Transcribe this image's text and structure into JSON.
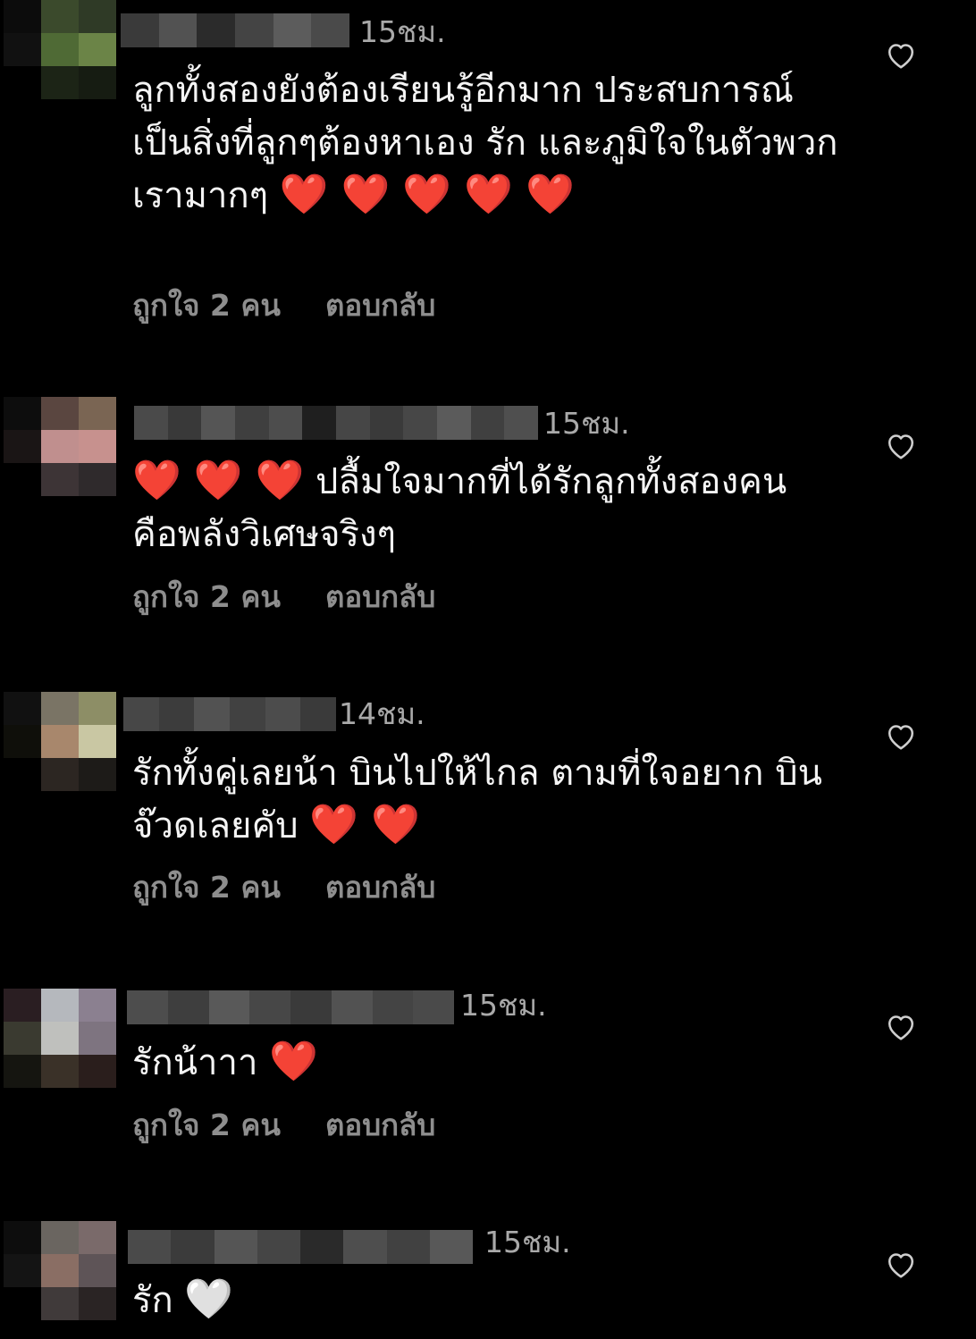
{
  "colors": {
    "background": "#000000",
    "text": "#f4f4f4",
    "secondary_text": "#8e8e8e",
    "heart_red": "#ff2a2a"
  },
  "comments": [
    {
      "time": "15ชม.",
      "text": "ลูกทั้งสองยังต้องเรียนรู้อีกมาก ประสบการณ์เป็นสิ่งที่ลูกๆต้องหาเอง  รัก และภูมิใจในตัวพวกเรามากๆ",
      "emoji": "❤️ ❤️ ❤️ ❤️ ❤️",
      "likes": "ถูกใจ 2 คน",
      "reply": "ตอบกลับ",
      "like_icon": "heart-outline-icon"
    },
    {
      "time": "15ชม.",
      "emoji_prefix": "❤️ ❤️ ❤️",
      "text": "ปลื้มใจมากที่ได้รักลูกทั้งสองคน คือพลังวิเศษจริงๆ",
      "likes": "ถูกใจ 2 คน",
      "reply": "ตอบกลับ",
      "like_icon": "heart-outline-icon"
    },
    {
      "time": "14ชม.",
      "text": "รักทั้งคู่เลยน้า บินไปให้ไกล ตามที่ใจอยาก บิน จ๊วดเลยคับ",
      "emoji": "❤️ ❤️",
      "likes": "ถูกใจ 2 คน",
      "reply": "ตอบกลับ",
      "like_icon": "heart-outline-icon"
    },
    {
      "time": "15ชม.",
      "text": "รักน้าาา",
      "emoji": "❤️",
      "likes": "ถูกใจ 2 คน",
      "reply": "ตอบกลับ",
      "like_icon": "heart-outline-icon"
    },
    {
      "time": "15ชม.",
      "text": "รัก",
      "emoji": "🤍",
      "like_icon": "heart-outline-icon"
    }
  ]
}
